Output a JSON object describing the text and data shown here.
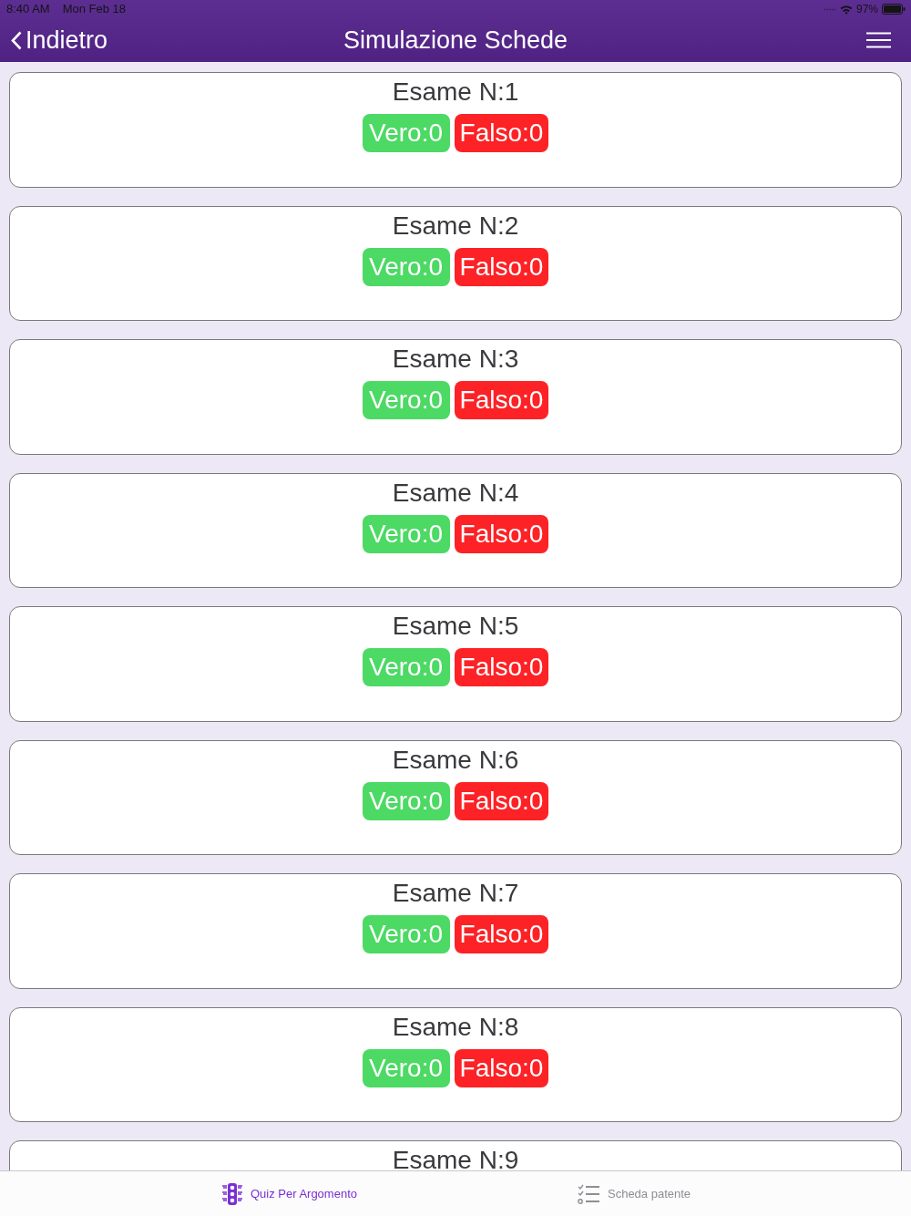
{
  "status_bar": {
    "time": "8:40 AM",
    "date": "Mon Feb 18",
    "battery": "97%"
  },
  "nav_bar": {
    "back": "Indietro",
    "title": "Simulazione Schede"
  },
  "exams": [
    {
      "title": "Esame N:1",
      "scores": [
        {
          "kind": "correct",
          "label": "Vero:0"
        },
        {
          "kind": "wrong",
          "label": "Falso:0"
        }
      ]
    },
    {
      "title": "Esame N:2",
      "scores": [
        {
          "kind": "correct",
          "label": "Vero:0"
        },
        {
          "kind": "wrong",
          "label": "Falso:0"
        }
      ]
    },
    {
      "title": "Esame N:3",
      "scores": [
        {
          "kind": "correct",
          "label": "Vero:0"
        },
        {
          "kind": "wrong",
          "label": "Falso:0"
        }
      ]
    },
    {
      "title": "Esame N:4",
      "scores": [
        {
          "kind": "correct",
          "label": "Vero:0"
        },
        {
          "kind": "wrong",
          "label": "Falso:0"
        }
      ]
    },
    {
      "title": "Esame N:5",
      "scores": [
        {
          "kind": "correct",
          "label": "Vero:0"
        },
        {
          "kind": "wrong",
          "label": "Falso:0"
        }
      ]
    },
    {
      "title": "Esame N:6",
      "scores": [
        {
          "kind": "correct",
          "label": "Vero:0"
        },
        {
          "kind": "wrong",
          "label": "Falso:0"
        }
      ]
    },
    {
      "title": "Esame N:7",
      "scores": [
        {
          "kind": "correct",
          "label": "Vero:0"
        },
        {
          "kind": "wrong",
          "label": "Falso:0"
        }
      ]
    },
    {
      "title": "Esame N:8",
      "scores": [
        {
          "kind": "correct",
          "label": "Vero:0"
        },
        {
          "kind": "wrong",
          "label": "Falso:0"
        }
      ]
    },
    {
      "title": "Esame N:9"
    }
  ],
  "tabs": [
    {
      "kind": "traffic_light",
      "label": "Quiz Per Argomento",
      "selected": true
    },
    {
      "kind": "checklist",
      "label": "Scheda patente",
      "selected": false
    }
  ]
}
